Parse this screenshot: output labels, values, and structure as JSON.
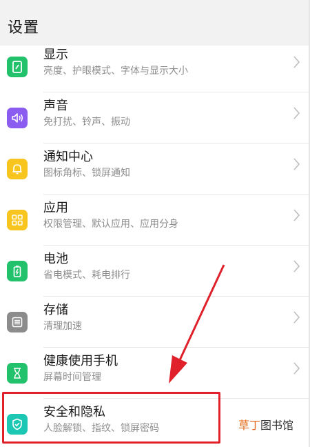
{
  "header": {
    "title": "设置"
  },
  "items": [
    {
      "label": "显示",
      "sub": "亮度、护眼模式、字体与显示大小",
      "icon": "display-icon",
      "color": "#22c16b"
    },
    {
      "label": "声音",
      "sub": "免打扰、铃声、振动",
      "icon": "speaker-icon",
      "color": "#8a5cf0"
    },
    {
      "label": "通知中心",
      "sub": "图标角标、锁屏通知",
      "icon": "bell-icon",
      "color": "#f7c51e"
    },
    {
      "label": "应用",
      "sub": "权限管理、默认应用、应用分身",
      "icon": "apps-grid-icon",
      "color": "#f7c51e"
    },
    {
      "label": "电池",
      "sub": "省电模式、耗电排行",
      "icon": "battery-icon",
      "color": "#22c16b"
    },
    {
      "label": "存储",
      "sub": "清理加速",
      "icon": "storage-icon",
      "color": "#8c8c8c"
    },
    {
      "label": "健康使用手机",
      "sub": "屏幕时间管理",
      "icon": "hourglass-icon",
      "color": "#22c16b"
    },
    {
      "label": "安全和隐私",
      "sub": "人脸解锁、指纹、锁屏密码",
      "icon": "shield-check-icon",
      "color": "#1cc7b4"
    }
  ],
  "watermark": {
    "accent": "草丁",
    "rest": "图书馆"
  },
  "annotation": {
    "highlight_color": "#e0202a"
  }
}
